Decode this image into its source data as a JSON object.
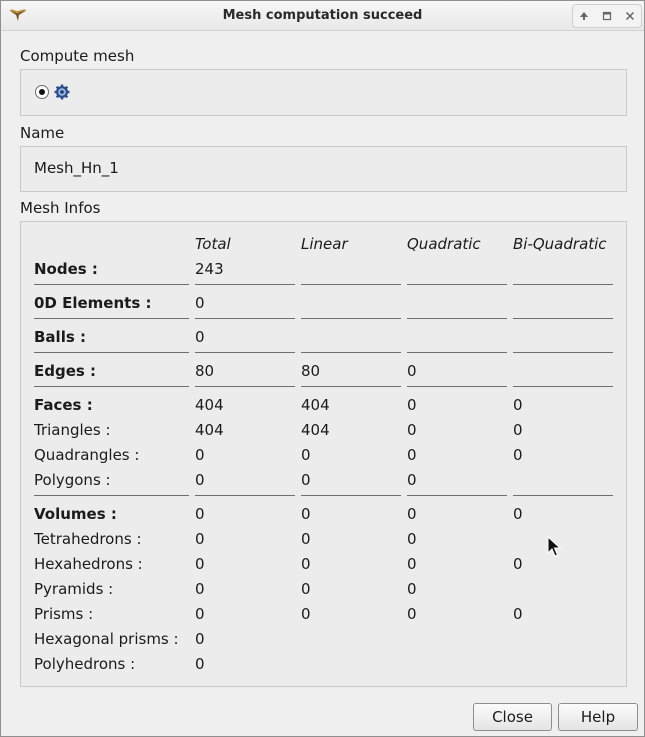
{
  "window": {
    "title": "Mesh computation succeed",
    "controls": [
      "up-arrow-icon",
      "restore-icon",
      "close-icon"
    ]
  },
  "compute_mesh": {
    "label": "Compute mesh",
    "radio_selected": true,
    "icon": "gear-icon"
  },
  "name_section": {
    "label": "Name",
    "value": "Mesh_Hn_1"
  },
  "mesh_infos": {
    "label": "Mesh Infos",
    "columns": [
      "Total",
      "Linear",
      "Quadratic",
      "Bi-Quadratic"
    ],
    "rows": [
      {
        "label": "Nodes :",
        "bold": true,
        "values": [
          "243",
          "",
          "",
          ""
        ]
      },
      {
        "label": "0D Elements :",
        "bold": true,
        "values": [
          "0",
          "",
          "",
          ""
        ]
      },
      {
        "label": "Balls :",
        "bold": true,
        "values": [
          "0",
          "",
          "",
          ""
        ]
      },
      {
        "label": "Edges :",
        "bold": true,
        "values": [
          "80",
          "80",
          "0",
          ""
        ]
      },
      {
        "label": "Faces :",
        "bold": true,
        "values": [
          "404",
          "404",
          "0",
          "0"
        ]
      },
      {
        "label": "Triangles :",
        "bold": false,
        "values": [
          "404",
          "404",
          "0",
          "0"
        ]
      },
      {
        "label": "Quadrangles :",
        "bold": false,
        "values": [
          "0",
          "0",
          "0",
          "0"
        ]
      },
      {
        "label": "Polygons :",
        "bold": false,
        "values": [
          "0",
          "0",
          "0",
          ""
        ]
      },
      {
        "label": "Volumes :",
        "bold": true,
        "values": [
          "0",
          "0",
          "0",
          "0"
        ]
      },
      {
        "label": "Tetrahedrons :",
        "bold": false,
        "values": [
          "0",
          "0",
          "0",
          ""
        ]
      },
      {
        "label": "Hexahedrons :",
        "bold": false,
        "values": [
          "0",
          "0",
          "0",
          "0"
        ]
      },
      {
        "label": "Pyramids :",
        "bold": false,
        "values": [
          "0",
          "0",
          "0",
          ""
        ]
      },
      {
        "label": "Prisms :",
        "bold": false,
        "values": [
          "0",
          "0",
          "0",
          "0"
        ]
      },
      {
        "label": "Hexagonal prisms :",
        "bold": false,
        "values": [
          "0",
          "",
          "",
          ""
        ]
      },
      {
        "label": "Polyhedrons :",
        "bold": false,
        "values": [
          "0",
          "",
          "",
          ""
        ]
      }
    ]
  },
  "buttons": {
    "close": "Close",
    "help": "Help"
  }
}
